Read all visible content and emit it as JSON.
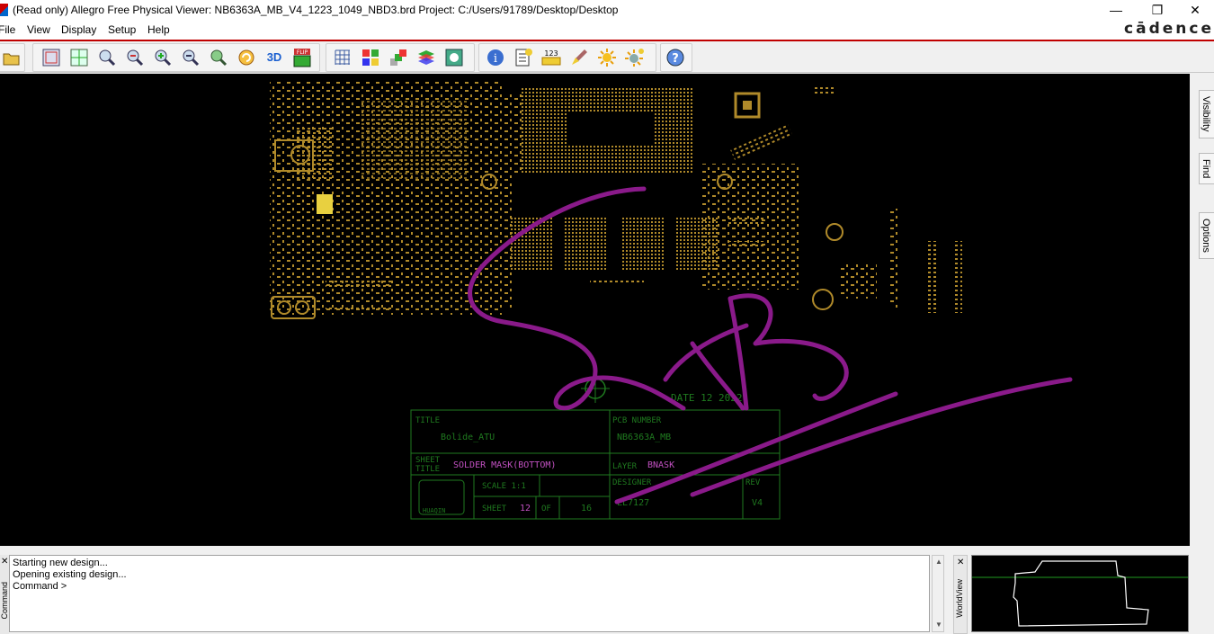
{
  "window": {
    "title": "(Read only) Allegro Free Physical Viewer: NB6363A_MB_V4_1223_1049_NBD3.brd  Project: C:/Users/91789/Desktop/Desktop",
    "minimize": "—",
    "maximize": "❐",
    "close": "✕"
  },
  "brand": "cādence",
  "menu": [
    {
      "label": "File",
      "key": "F"
    },
    {
      "label": "View",
      "key": "V"
    },
    {
      "label": "Display",
      "key": "D"
    },
    {
      "label": "Setup",
      "key": "S"
    },
    {
      "label": "Help",
      "key": "H"
    }
  ],
  "menu_labels": {
    "file": "File",
    "view": "View",
    "display": "Display",
    "setup": "Setup",
    "help": "Help"
  },
  "toolbar_icons": {
    "open": "open-folder-icon",
    "zoom_points": "zoom-points-icon",
    "zoom_fit": "zoom-fit-icon",
    "zoom_in": "zoom-in-icon",
    "zoom_out": "zoom-out-icon",
    "flip": "flip-icon",
    "grid": "grid-icon",
    "info": "info-icon",
    "help": "help-icon"
  },
  "toolbar_text": {
    "three_d": "3D",
    "flip": "FLIP",
    "num": "123"
  },
  "side_tabs": {
    "visibility": "Visibility",
    "find": "Find",
    "options": "Options"
  },
  "console": {
    "lines": [
      "Starting new design...",
      "Opening existing design...",
      "Command >"
    ],
    "dock_label": "Command",
    "close": "✕"
  },
  "worldview": {
    "dock_label": "WorldView",
    "close": "✕"
  },
  "titleblock": {
    "title_label": "TITLE",
    "title_value": "Bolide_ATU",
    "pcb_label": "PCB NUMBER",
    "pcb_value": "NB6363A_MB",
    "sheet_title_label_1": "SHEET",
    "sheet_title_label_2": "TITLE",
    "sheet_title_value": "SOLDER MASK(BOTTOM)",
    "layer_label": "LAYER",
    "layer_value": "BNASK",
    "scale_label": "SCALE 1:1",
    "design_label": "DESIGNER",
    "design_value": "LL7127",
    "rev_label": "REV",
    "rev_value": "V4",
    "sheet_label": "SHEET",
    "sheet_no": "12",
    "of_label": "OF",
    "sheet_total": "16",
    "date_text": "DATE 12    2022",
    "logo_text": "HUAQIN"
  },
  "colors": {
    "canvas": "#000000",
    "silk": "#b08a2a",
    "titleblock": "#1f7a1f",
    "text_magenta": "#c050c0",
    "annotation": "#8a1a8a",
    "accent": "#c00000"
  }
}
